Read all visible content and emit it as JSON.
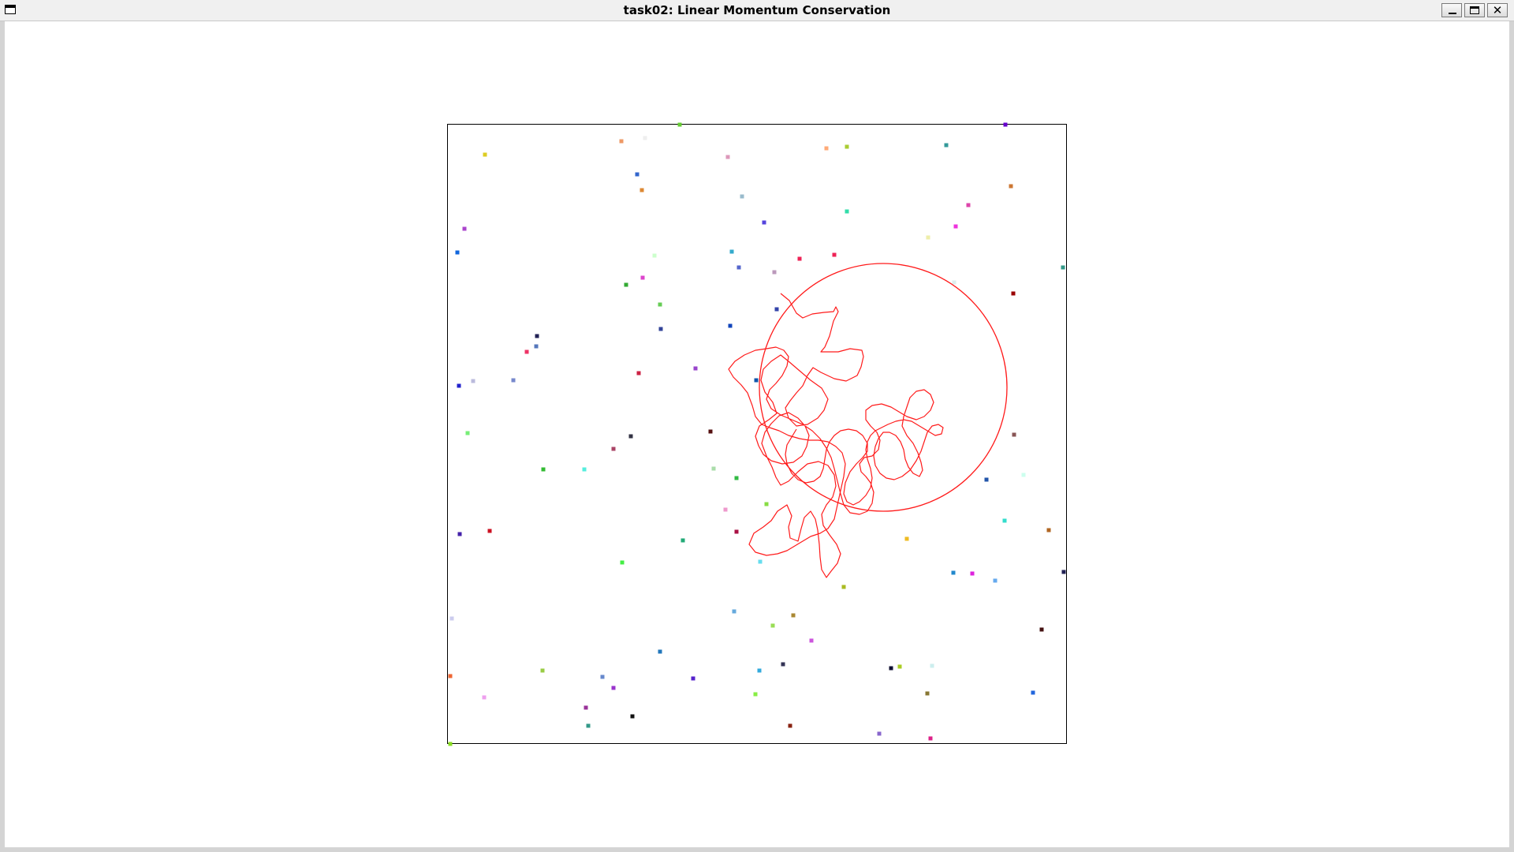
{
  "window": {
    "title": "task02: Linear Momentum Conservation",
    "min_label": "",
    "max_label": "",
    "close_label": "✕"
  },
  "colors": {
    "trajectory": "#ff1a1a",
    "box_border": "#000000",
    "background": "#ffffff"
  },
  "particles": [
    [
      "#66cc33",
      862,
      158
    ],
    [
      "#6600cc",
      1275,
      158
    ],
    [
      "#ddcc22",
      615,
      196
    ],
    [
      "#ee9966",
      788,
      179
    ],
    [
      "#eeeeee",
      818,
      175
    ],
    [
      "#dd99bb",
      923,
      199
    ],
    [
      "#ffaa77",
      1048,
      188
    ],
    [
      "#aacc33",
      1074,
      186
    ],
    [
      "#339999",
      1200,
      184
    ],
    [
      "#3366cc",
      808,
      221
    ],
    [
      "#dd8833",
      814,
      241
    ],
    [
      "#99bbcc",
      941,
      249
    ],
    [
      "#cc7733",
      1282,
      236
    ],
    [
      "#dd44aa",
      1228,
      260
    ],
    [
      "#33ddaa",
      1074,
      268
    ],
    [
      "#aa44cc",
      589,
      290
    ],
    [
      "#5544dd",
      969,
      282
    ],
    [
      "#ee33dd",
      1212,
      287
    ],
    [
      "#1166dd",
      580,
      320
    ],
    [
      "#ccffcc",
      830,
      324
    ],
    [
      "#33aacc",
      928,
      319
    ],
    [
      "#ee2255",
      1014,
      328
    ],
    [
      "#ee2255",
      1058,
      323
    ],
    [
      "#eeeeaa",
      1177,
      301
    ],
    [
      "#339988",
      1348,
      339
    ],
    [
      "#5566cc",
      937,
      339
    ],
    [
      "#bb99bb",
      982,
      345
    ],
    [
      "#33aa33",
      794,
      361
    ],
    [
      "#dd44cc",
      815,
      352
    ],
    [
      "#ddeeee",
      1210,
      358
    ],
    [
      "#990000",
      1285,
      372
    ],
    [
      "#66cc55",
      837,
      386
    ],
    [
      "#3344aa",
      985,
      392
    ],
    [
      "#334499",
      838,
      417
    ],
    [
      "#222255",
      681,
      426
    ],
    [
      "#5577bb",
      680,
      439
    ],
    [
      "#ee3366",
      668,
      446
    ],
    [
      "#1144bb",
      926,
      413
    ],
    [
      "#9944cc",
      882,
      467
    ],
    [
      "#2222cc",
      582,
      489
    ],
    [
      "#bbbbdd",
      600,
      483
    ],
    [
      "#7788cc",
      651,
      482
    ],
    [
      "#cc2244",
      810,
      473
    ],
    [
      "#1155aa",
      959,
      482
    ],
    [
      "#77ee77",
      593,
      549
    ],
    [
      "#333344",
      800,
      553
    ],
    [
      "#551111",
      901,
      547
    ],
    [
      "#aa4466",
      778,
      569
    ],
    [
      "#885555",
      1286,
      551
    ],
    [
      "#33bb33",
      689,
      595
    ],
    [
      "#55eedd",
      741,
      595
    ],
    [
      "#aaddaa",
      905,
      594
    ],
    [
      "#33bb44",
      934,
      606
    ],
    [
      "#2255aa",
      1251,
      608
    ],
    [
      "#ccffee",
      1298,
      602
    ],
    [
      "#ee99cc",
      920,
      646
    ],
    [
      "#88dd44",
      972,
      639
    ],
    [
      "#33ddcc",
      1274,
      660
    ],
    [
      "#4422aa",
      583,
      677
    ],
    [
      "#cc1122",
      621,
      673
    ],
    [
      "#aa1144",
      934,
      674
    ],
    [
      "#22aa77",
      866,
      685
    ],
    [
      "#eebb22",
      1150,
      683
    ],
    [
      "#b06622",
      1330,
      672
    ],
    [
      "#44ee44",
      789,
      713
    ],
    [
      "#66ddee",
      964,
      712
    ],
    [
      "#aabb22",
      1070,
      744
    ],
    [
      "#2288cc",
      1209,
      726
    ],
    [
      "#dd22dd",
      1233,
      727
    ],
    [
      "#66aaee",
      1262,
      736
    ],
    [
      "#222255",
      1349,
      725
    ],
    [
      "#ccccee",
      573,
      784
    ],
    [
      "#66aadd",
      931,
      775
    ],
    [
      "#aa8833",
      1006,
      780
    ],
    [
      "#99dd55",
      980,
      793
    ],
    [
      "#cc55dd",
      1029,
      812
    ],
    [
      "#441111",
      1321,
      798
    ],
    [
      "#2277bb",
      837,
      826
    ],
    [
      "#ee6633",
      571,
      857
    ],
    [
      "#99cc44",
      688,
      850
    ],
    [
      "#6688cc",
      764,
      858
    ],
    [
      "#5522cc",
      879,
      860
    ],
    [
      "#9933cc",
      778,
      872
    ],
    [
      "#33aadd",
      963,
      850
    ],
    [
      "#333355",
      993,
      842
    ],
    [
      "#111133",
      1130,
      847
    ],
    [
      "#aacc22",
      1141,
      845
    ],
    [
      "#cceeee",
      1182,
      844
    ],
    [
      "#eea0ee",
      614,
      884
    ],
    [
      "#88ee44",
      958,
      880
    ],
    [
      "#887733",
      1176,
      879
    ],
    [
      "#2266dd",
      1310,
      878
    ],
    [
      "#993399",
      743,
      897
    ],
    [
      "#339988",
      746,
      920
    ],
    [
      "#111111",
      802,
      908
    ],
    [
      "#882211",
      1002,
      920
    ],
    [
      "#8866cc",
      1115,
      930
    ],
    [
      "#dd2288",
      1180,
      936
    ],
    [
      "#88dd22",
      571,
      943
    ]
  ]
}
